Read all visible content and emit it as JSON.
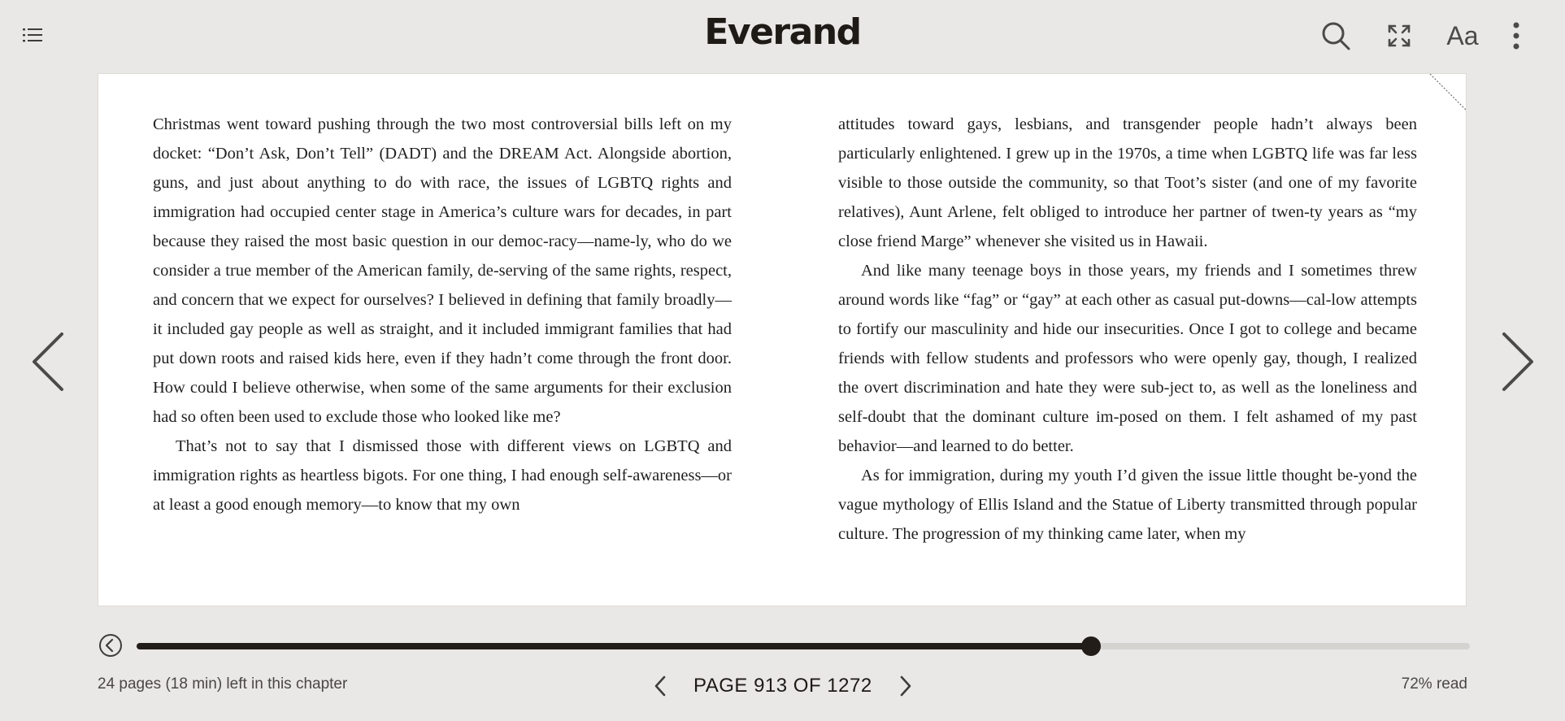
{
  "app": {
    "brand": "Everand"
  },
  "toolbar": {
    "icons": {
      "toc": "list-icon",
      "search": "search-icon",
      "fullscreen": "expand-icon",
      "font": "Aa",
      "more": "more-vertical-icon"
    }
  },
  "book": {
    "left_column": [
      {
        "text": "Christmas went toward pushing through the two most controversial bills left on my docket: “Don’t Ask, Don’t Tell” (DADT) and the DREAM Act. Alongside abortion, guns, and just about anything to do with race, the issues of LGBTQ rights and immigration had occupied center stage in America’s culture wars for decades, in part because they raised the most basic question in our democ-racy—name-ly, who do we consider a true member of the American family, de-serving of the same rights, respect, and concern that we expect for ourselves? I believed in defining that family broadly—it included gay people as well as straight, and it included immigrant families that had put down roots and raised kids here, even if they hadn’t come through the front door. How could I believe otherwise, when some of the same arguments for their exclusion had so often been used to exclude those who looked like me?",
        "indent": false
      },
      {
        "text": "That’s not to say that I dismissed those with different views on LGBTQ and immigration rights as heartless bigots. For one thing, I had enough self-awareness—or at least a good enough memory—to know that my own",
        "indent": true
      }
    ],
    "right_column": [
      {
        "text": "attitudes toward gays, lesbians, and transgender people hadn’t always been particularly enlightened. I grew up in the 1970s, a time when LGBTQ life was far less visible to those outside the community, so that Toot’s sister (and one of my favorite relatives), Aunt Arlene, felt obliged to introduce her partner of twen-ty years as “my close friend Marge” whenever she visited us in Hawaii.",
        "indent": false
      },
      {
        "text": "And like many teenage boys in those years, my friends and I sometimes threw around words like “fag” or “gay” at each other as casual put-downs—cal-low attempts to fortify our masculinity and hide our insecurities. Once I got to college and became friends with fellow students and professors who were openly gay, though, I realized the overt discrimination and hate they were sub-ject to, as well as the loneliness and self-doubt that the dominant culture im-posed on them. I felt ashamed of my past behavior—and learned to do better.",
        "indent": true
      },
      {
        "text": "As for immigration, during my youth I’d given the issue little thought be-yond the vague mythology of Ellis Island and the Statue of Liberty transmitted through popular culture. The progression of my thinking came later, when my",
        "indent": true
      }
    ]
  },
  "footer": {
    "progress_fraction": 0.716,
    "chapter_remaining": "24 pages (18 min) left in this chapter",
    "page_label": "PAGE 913 OF 1272",
    "read_percent": "72% read"
  }
}
